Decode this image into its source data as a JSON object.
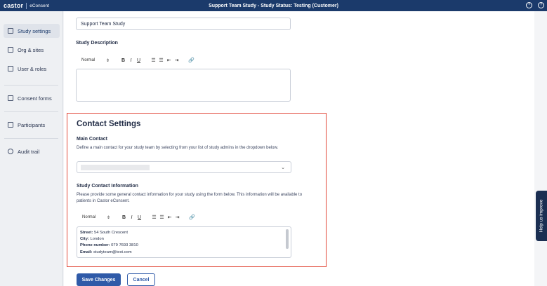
{
  "app": {
    "brand": "castor",
    "product": "eConsent",
    "title": "Support Team Study  - Study Status: Testing (Customer)"
  },
  "sidebar": {
    "items": [
      {
        "label": "Study settings",
        "icon": "study-settings-icon",
        "active": true
      },
      {
        "label": "Org & sites",
        "icon": "building-icon"
      },
      {
        "label": "User & roles",
        "icon": "users-icon"
      },
      {
        "label": "Consent forms",
        "icon": "document-icon"
      },
      {
        "label": "Participants",
        "icon": "participants-icon"
      },
      {
        "label": "Audit trail",
        "icon": "history-icon"
      }
    ]
  },
  "study": {
    "name_value": "Support Team Study",
    "description_label": "Study Description"
  },
  "editor": {
    "format_label": "Normal",
    "bold": "B",
    "italic": "I",
    "underline": "U"
  },
  "contact": {
    "title": "Contact Settings",
    "main_contact_label": "Main Contact",
    "main_contact_help": "Define a main contact for your study team by selecting from your list of study admins in the dropdown below.",
    "info_label": "Study Contact Information",
    "info_help": "Please provide some general contact information for your study using the form below. This information will be available to patients in Castor eConsent.",
    "address": [
      {
        "key": "Street",
        "value": "54 South Crescent"
      },
      {
        "key": "City",
        "value": "London"
      },
      {
        "key": "Phone number",
        "value": "079 7693 3810"
      },
      {
        "key": "Email",
        "value": "studyteam@test.com"
      }
    ]
  },
  "actions": {
    "save": "Save Changes",
    "cancel": "Cancel"
  },
  "help_tab": "Help us improve",
  "colors": {
    "topbar": "#1b3a6b",
    "highlight": "#e24a3b",
    "primary": "#2f5aa8"
  }
}
